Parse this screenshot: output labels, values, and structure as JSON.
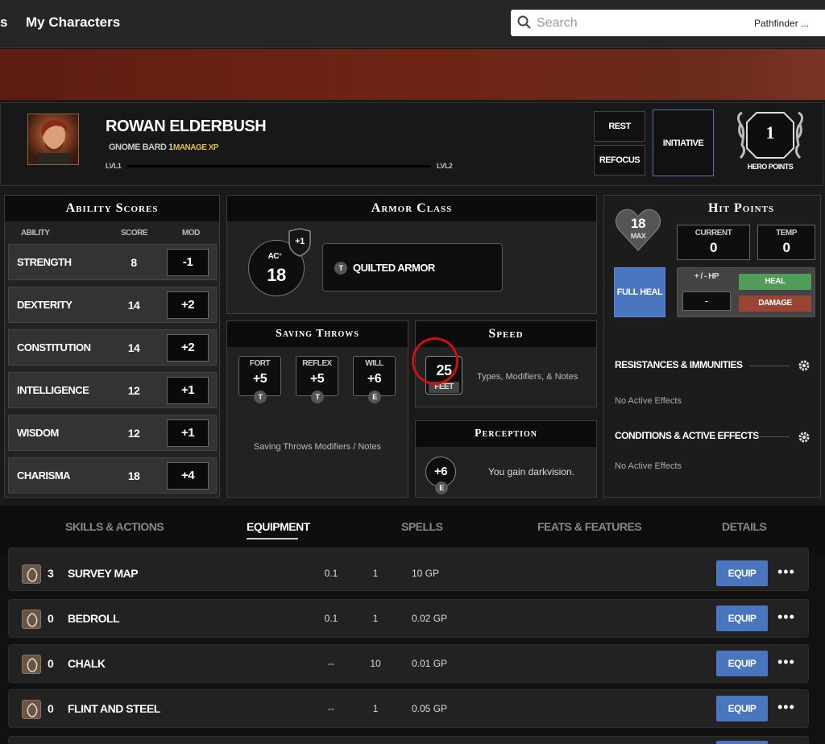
{
  "nav": {
    "left_fragment": "s",
    "my_characters": "My Characters",
    "search_placeholder": "Search",
    "game_select": "Pathfinder ..."
  },
  "character": {
    "name": "ROWAN ELDERBUSH",
    "subtitle": "GNOME BARD 1",
    "manage_xp": "MANAGE XP",
    "level_start": "LVL1",
    "level_end": "LVL2",
    "xp_progress": 0
  },
  "header_buttons": {
    "rest": "REST",
    "refocus": "REFOCUS",
    "initiative": "INITIATIVE",
    "hero_points_value": "1",
    "hero_points_label": "HERO POINTS"
  },
  "abilities": {
    "title": "Ability Scores",
    "col_ability": "ABILITY",
    "col_score": "SCORE",
    "col_mod": "MOD",
    "rows": [
      {
        "name": "STRENGTH",
        "score": "8",
        "mod": "-1"
      },
      {
        "name": "DEXTERITY",
        "score": "14",
        "mod": "+2"
      },
      {
        "name": "CONSTITUTION",
        "score": "14",
        "mod": "+2"
      },
      {
        "name": "INTELLIGENCE",
        "score": "12",
        "mod": "+1"
      },
      {
        "name": "WISDOM",
        "score": "12",
        "mod": "+1"
      },
      {
        "name": "CHARISMA",
        "score": "18",
        "mod": "+4"
      }
    ]
  },
  "armor_class": {
    "title": "Armor Class",
    "label": "AC",
    "star": "*",
    "value": "18",
    "shield_bonus": "+1",
    "armor_badge": "T",
    "armor_name": "QUILTED ARMOR"
  },
  "saving_throws": {
    "title": "Saving Throws",
    "saves": [
      {
        "name": "FORT",
        "value": "+5",
        "prof": "T"
      },
      {
        "name": "REFLEX",
        "value": "+5",
        "prof": "T"
      },
      {
        "name": "WILL",
        "value": "+6",
        "prof": "E"
      }
    ],
    "notes": "Saving Throws Modifiers / Notes"
  },
  "speed": {
    "title": "Speed",
    "value": "25",
    "unit": "FEET",
    "notes": "Types, Modifiers, & Notes"
  },
  "perception": {
    "title": "Perception",
    "value": "+6",
    "prof": "E",
    "note": "You gain darkvision."
  },
  "hit_points": {
    "title": "Hit Points",
    "max_value": "18",
    "max_label": "MAX",
    "current_label": "CURRENT",
    "current_value": "0",
    "temp_label": "TEMP",
    "temp_value": "0",
    "full_heal": "FULL HEAL",
    "adjust_label": "+ / - HP",
    "adjust_value": "-",
    "heal": "HEAL",
    "damage": "DAMAGE",
    "resistances_title": "RESISTANCES & IMMUNITIES",
    "resistances_empty": "No Active Effects",
    "conditions_title": "CONDITIONS & ACTIVE EFFECTS",
    "conditions_empty": "No Active Effects"
  },
  "tabs": [
    {
      "label": "SKILLS & ACTIONS",
      "active": false
    },
    {
      "label": "EQUIPMENT",
      "active": true
    },
    {
      "label": "SPELLS",
      "active": false
    },
    {
      "label": "FEATS & FEATURES",
      "active": false
    },
    {
      "label": "DETAILS",
      "active": false
    }
  ],
  "equipment": {
    "equip_label": "EQUIP",
    "more_label": "•••",
    "items": [
      {
        "qty": "3",
        "name": "SURVEY MAP",
        "bulk": "0.1",
        "count": "1",
        "price": "10 GP"
      },
      {
        "qty": "0",
        "name": "BEDROLL",
        "bulk": "0.1",
        "count": "1",
        "price": "0.02 GP"
      },
      {
        "qty": "0",
        "name": "CHALK",
        "bulk": "--",
        "count": "10",
        "price": "0.01 GP"
      },
      {
        "qty": "0",
        "name": "FLINT AND STEEL",
        "bulk": "--",
        "count": "1",
        "price": "0.05 GP"
      }
    ]
  },
  "colors": {
    "banner": "#6a2416",
    "equip_button": "#4a76c0",
    "heal": "#4f9d58",
    "damage": "#9a4434",
    "speed_highlight": "#d01010"
  }
}
